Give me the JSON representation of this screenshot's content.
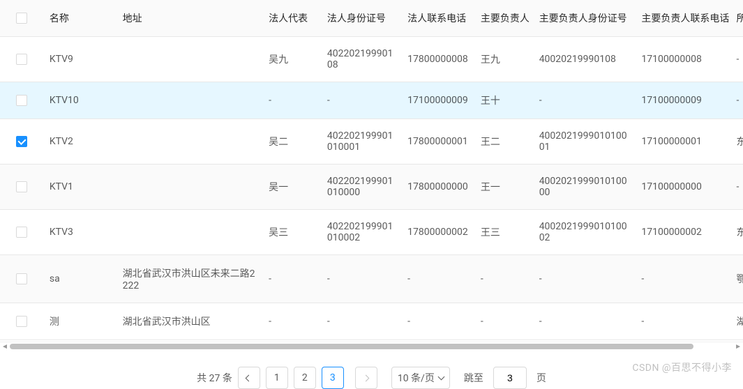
{
  "table": {
    "headers": {
      "name": "名称",
      "address": "地址",
      "legal_rep": "法人代表",
      "legal_id": "法人身份证号",
      "legal_phone": "法人联系电话",
      "principal": "主要负责人",
      "principal_id": "主要负责人身份证号",
      "principal_phone": "主要负责人联系电话",
      "region": "所属"
    },
    "rows": [
      {
        "checked": false,
        "highlighted": false,
        "alt": false,
        "name": "KTV9",
        "address": "",
        "legal_rep": "吴九",
        "legal_id": "40220219990108",
        "legal_phone": "17800000008",
        "principal": "王九",
        "principal_id": "40020219990108",
        "principal_phone": "17100000008",
        "region": "-"
      },
      {
        "checked": false,
        "highlighted": true,
        "alt": false,
        "name": "KTV10",
        "address": "",
        "legal_rep": "-",
        "legal_id": "-",
        "legal_phone": "17100000009",
        "principal": "王十",
        "principal_id": "-",
        "principal_phone": "17100000009",
        "region": "-"
      },
      {
        "checked": true,
        "highlighted": false,
        "alt": false,
        "name": "KTV2",
        "address": "",
        "legal_rep": "吴二",
        "legal_id": "402202199901010001",
        "legal_phone": "17800000001",
        "principal": "王二",
        "principal_id": "400202199901010001",
        "principal_phone": "17100000001",
        "region": "东门"
      },
      {
        "checked": false,
        "highlighted": false,
        "alt": true,
        "name": "KTV1",
        "address": "",
        "legal_rep": "吴一",
        "legal_id": "402202199901010000",
        "legal_phone": "17800000000",
        "principal": "王一",
        "principal_id": "400202199901010000",
        "principal_phone": "17100000000",
        "region": "-"
      },
      {
        "checked": false,
        "highlighted": false,
        "alt": false,
        "name": "KTV3",
        "address": "",
        "legal_rep": "吴三",
        "legal_id": "402202199901010002",
        "legal_phone": "17800000002",
        "principal": "王三",
        "principal_id": "400202199901010002",
        "principal_phone": "17100000002",
        "region": "东门"
      },
      {
        "checked": false,
        "highlighted": false,
        "alt": true,
        "name": "sa",
        "address": "湖北省武汉市洪山区未来二路2222",
        "legal_rep": "-",
        "legal_id": "-",
        "legal_phone": "-",
        "principal": "-",
        "principal_id": "-",
        "principal_phone": "-",
        "region": "鄂州"
      },
      {
        "checked": false,
        "highlighted": false,
        "alt": false,
        "name": "测",
        "address": "湖北省武汉市洪山区",
        "legal_rep": "-",
        "legal_id": "-",
        "legal_phone": "-",
        "principal": "-",
        "principal_id": "-",
        "principal_phone": "-",
        "region": "湖北"
      }
    ]
  },
  "pagination": {
    "total_label": "共 27 条",
    "pages": [
      "1",
      "2",
      "3"
    ],
    "active_page": "3",
    "page_size_label": "10 条/页",
    "jump_label": "跳至",
    "jump_value": "3",
    "jump_suffix": "页"
  },
  "watermark": "CSDN @百思不得小李"
}
